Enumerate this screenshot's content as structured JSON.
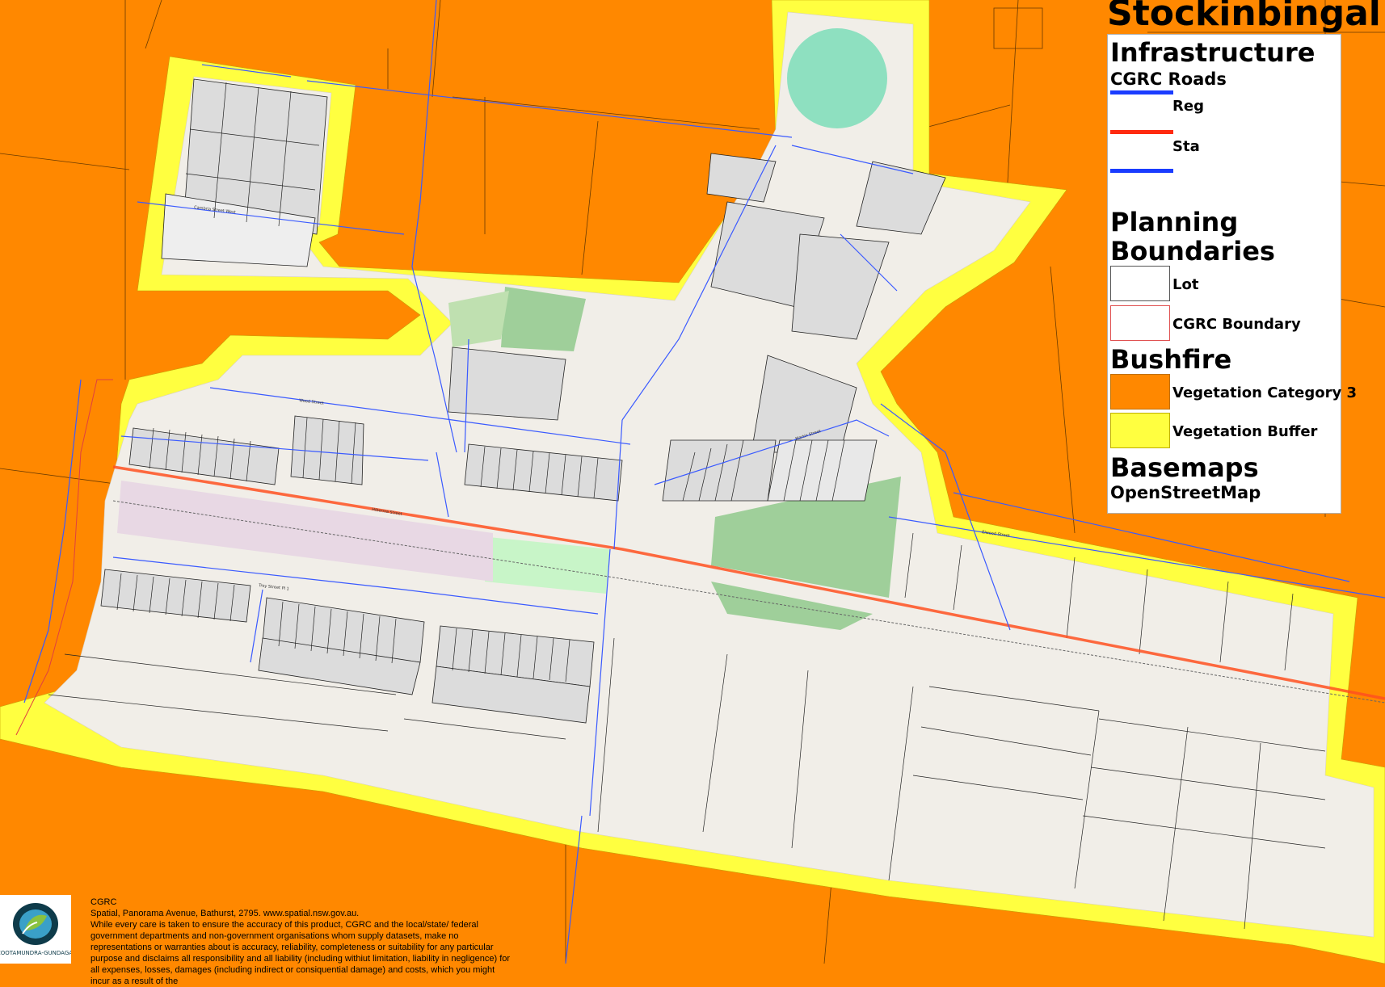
{
  "title": "Stockinbingal",
  "colors": {
    "vegetation_category_3": "#ff8800",
    "vegetation_buffer": "#ffff40",
    "land": "#f1eee8",
    "regional_road": "#1a3cff",
    "state_road": "#ff2a10",
    "lot_outline": "#222222",
    "cgrc_boundary": "#e05050"
  },
  "legend": {
    "infrastructure_heading": "Infrastructure",
    "roads_heading": "CGRC Roads",
    "roads": [
      {
        "label": "Reg",
        "color": "#ffffff"
      },
      {
        "label": "Sta",
        "color": "#ffffff"
      }
    ],
    "planning_heading_line1": "Planning",
    "planning_heading_line2": "Boundaries",
    "planning_items": [
      {
        "label": "Lot",
        "icon": "lot-outline-swatch"
      },
      {
        "label": "CGRC Boundary",
        "icon": "cgrc-boundary-swatch"
      }
    ],
    "bushfire_heading": "Bushfire",
    "bushfire_items": [
      {
        "label": "Vegetation Category 3",
        "color": "#ff8800"
      },
      {
        "label": "Vegetation Buffer",
        "color": "#ffff40"
      }
    ],
    "basemaps_heading": "Basemaps",
    "basemap_name": "OpenStreetMap"
  },
  "streets": {
    "hibernia": "Hibernia Street",
    "troy": "Troy Street Pl 1",
    "elwood": "Elwood Street",
    "cambria": "Cambria Street West",
    "wood": "Wood Street",
    "martin": "Martin Street"
  },
  "footer": {
    "org": "CGRC",
    "address": "Spatial, Panorama Avenue, Bathurst, 2795. www.spatial.nsw.gov.au.",
    "disclaimer": "While every care is taken to ensure the accuracy of this product, CGRC and the local/state/ federal government departments and non-government organisations whom supply datasets, make no representations or warranties about is accuracy, reliability, completeness or suitability for any particular purpose and disclaims all responsibility and all liability (including withiut limitation, liability in negligence) for all expenses, losses, damages (including indirect or consiquential damage) and costs, which you might incur as a result of the",
    "logo_text": "COOTAMUNDRA-GUNDAGAI"
  }
}
